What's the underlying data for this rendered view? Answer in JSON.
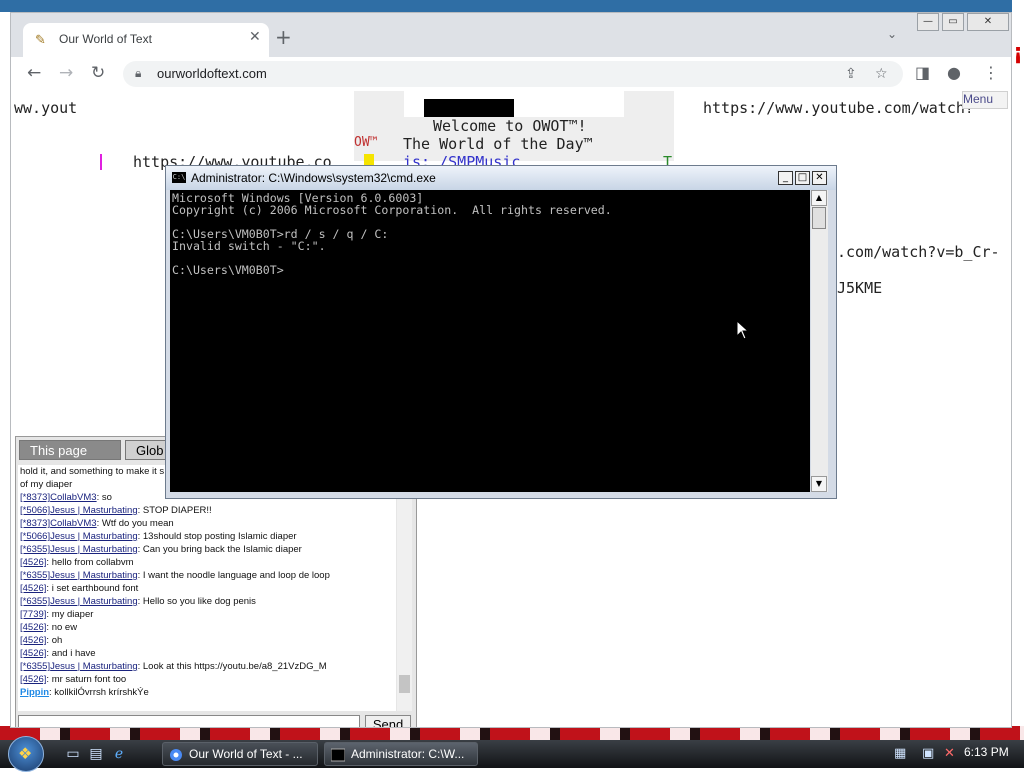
{
  "browser": {
    "tab_title": "Our World of Text",
    "tab_close": "✕",
    "new_tab": "+",
    "url": "ourworldoftext.com",
    "window_controls": {
      "minimize": "—",
      "maximize": "▭",
      "close": "✕"
    }
  },
  "owot": {
    "top_left": "ww.yout",
    "top_right": "https://www.youtube.com/watch?",
    "left_link": "https://www.youtube.co",
    "welcome": "Welcome to OWOT™!",
    "wotd_prefix": "OW™",
    "wotd": "The World of the Day™",
    "wotd_is": "is: /SMPMusic",
    "right_link": ".com/watch?v=b_Cr-",
    "right_code": "J5KME",
    "menu": "Menu",
    "t_char": "T"
  },
  "chat": {
    "tab_this_page": "This page",
    "tab_global": "Glob",
    "lines": [
      {
        "id": "",
        "user": "",
        "text": "hold it, and something to make it s"
      },
      {
        "id": "",
        "user": "",
        "text": "of my diaper"
      },
      {
        "id": "[*8373]",
        "user": "CollabVM3",
        "text": ": so"
      },
      {
        "id": "[*5066]",
        "user": "Jesus | Masturbating",
        "text": ": STOP DIAPER!!"
      },
      {
        "id": "[*8373]",
        "user": "CollabVM3",
        "text": ": Wtf do you mean"
      },
      {
        "id": "[*5066]",
        "user": "Jesus | Masturbating",
        "text": ": 13should stop posting Islamic diaper"
      },
      {
        "id": "[*6355]",
        "user": "Jesus | Masturbating",
        "text": ": Can you bring back the Islamic diaper"
      },
      {
        "id": "[4526]",
        "user": "",
        "text": ": hello from collabvm"
      },
      {
        "id": "[*6355]",
        "user": "Jesus | Masturbating",
        "text": ": I want the noodle language and loop de loop"
      },
      {
        "id": "[4526]",
        "user": "",
        "text": ": i set earthbound font"
      },
      {
        "id": "[*6355]",
        "user": "Jesus | Masturbating",
        "text": ": Hello so you like dog penis"
      },
      {
        "id": "[7739]",
        "user": "",
        "text": ": my diaper"
      },
      {
        "id": "[4526]",
        "user": "",
        "text": ": no ew"
      },
      {
        "id": "[4526]",
        "user": "",
        "text": ": oh"
      },
      {
        "id": "[4526]",
        "user": "",
        "text": ": and i have"
      },
      {
        "id": "[*6355]",
        "user": "Jesus | Masturbating",
        "text": ": Look at this https://youtu.be/a8_21VzDG_M"
      },
      {
        "id": "[4526]",
        "user": "",
        "text": ": mr saturn font too"
      },
      {
        "id": "",
        "user": "Pippin",
        "text": ": kollkilÓvrrsh krírshkÝe"
      }
    ],
    "input_value": "",
    "send_label": "Send"
  },
  "cmd": {
    "title": "Administrator: C:\\Windows\\system32\\cmd.exe",
    "icon_label": "C:\\",
    "output": "Microsoft Windows [Version 6.0.6003]\nCopyright (c) 2006 Microsoft Corporation.  All rights reserved.\n\nC:\\Users\\VM0B0T>rd / s / q / C:\nInvalid switch - \"C:\".\n\nC:\\Users\\VM0B0T>",
    "controls": {
      "minimize": "_",
      "maximize": "□",
      "close": "✕"
    }
  },
  "taskbar": {
    "tasks": [
      {
        "label": "Our World of Text - ..."
      },
      {
        "label": "Administrator: C:\\W..."
      }
    ],
    "clock": "6:13 PM"
  }
}
